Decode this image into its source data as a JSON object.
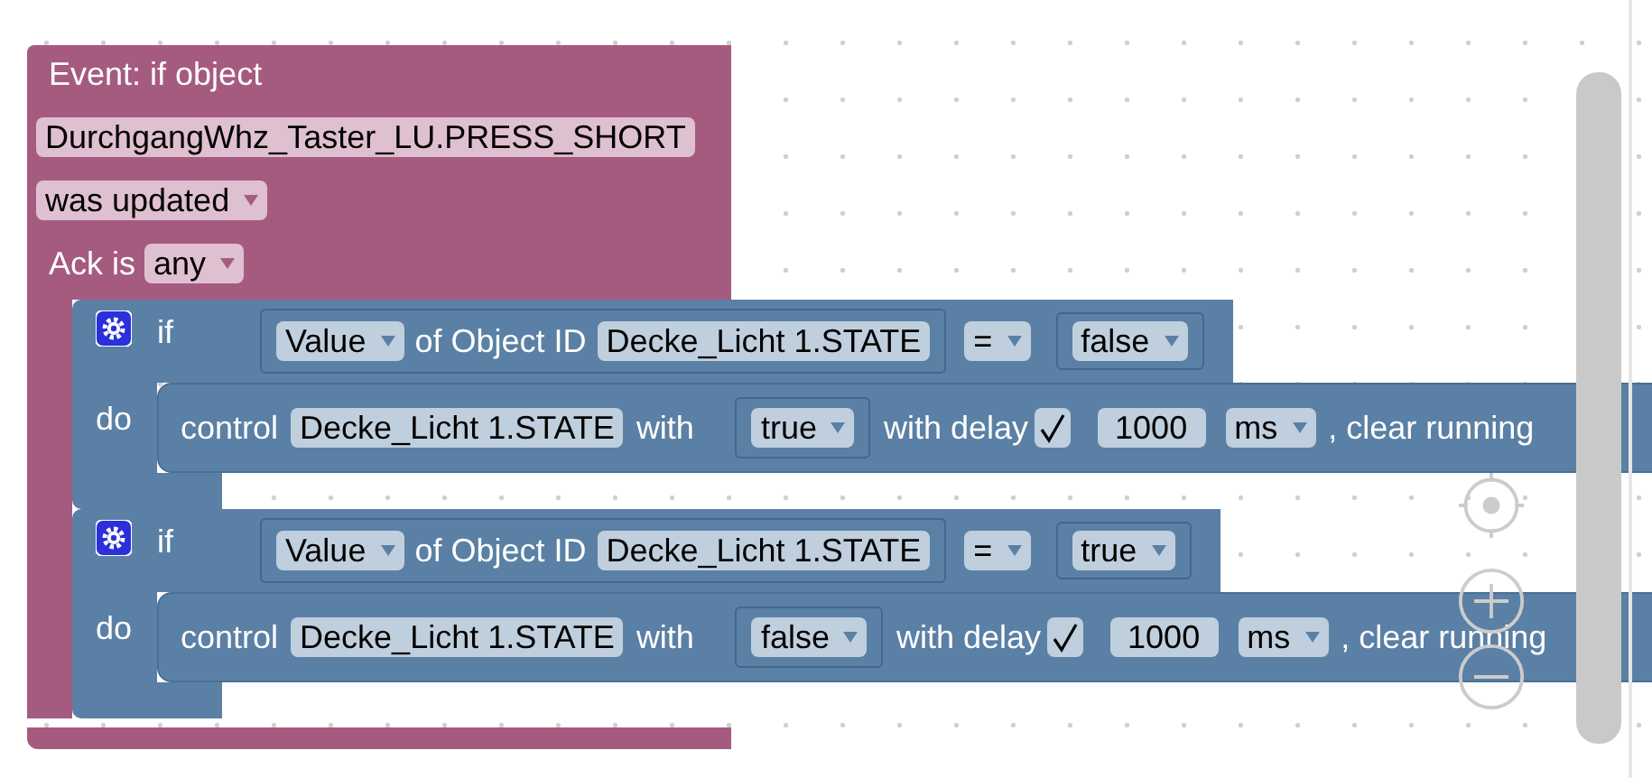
{
  "event": {
    "title": "Event: if object",
    "object_id": "DurchgangWhz_Taster_LU.PRESS_SHORT",
    "trigger": "was updated",
    "ack_label": "Ack is",
    "ack": "any"
  },
  "if_blocks": [
    {
      "if_label": "if",
      "condition": {
        "attribute": "Value",
        "of_label": "of Object ID",
        "object_id": "Decke_Licht 1.STATE",
        "operator": "=",
        "value": "false"
      },
      "do_label": "do",
      "action": {
        "control_label": "control",
        "object_id": "Decke_Licht 1.STATE",
        "with_label": "with",
        "value": "true",
        "delay_label": "with delay",
        "delay_checked": true,
        "delay": "1000",
        "unit": "ms",
        "clear_label": ", clear running"
      }
    },
    {
      "if_label": "if",
      "condition": {
        "attribute": "Value",
        "of_label": "of Object ID",
        "object_id": "Decke_Licht 1.STATE",
        "operator": "=",
        "value": "true"
      },
      "do_label": "do",
      "action": {
        "control_label": "control",
        "object_id": "Decke_Licht 1.STATE",
        "with_label": "with",
        "value": "false",
        "delay_label": "with delay",
        "delay_checked": true,
        "delay": "1000",
        "unit": "ms",
        "clear_label": ", clear running"
      }
    }
  ]
}
